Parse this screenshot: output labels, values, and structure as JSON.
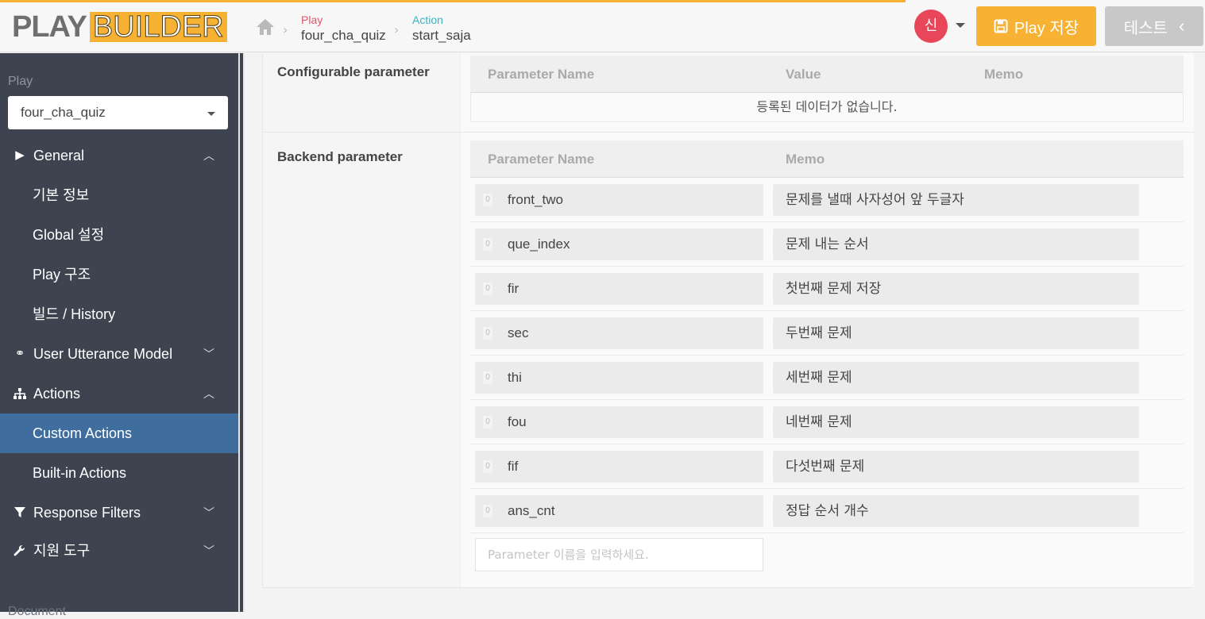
{
  "header": {
    "logo_play": "PLAY",
    "logo_builder": "BUILDER",
    "breadcrumb": [
      {
        "kind": "Play",
        "value": "four_cha_quiz"
      },
      {
        "kind": "Action",
        "value": "start_saja"
      }
    ],
    "avatar_initial": "신",
    "save_label": "Play 저장",
    "test_label": "테스트",
    "colors": {
      "accent": "#f7b233",
      "play_crumb": "#e05566",
      "action_crumb": "#3bb4c4",
      "avatar": "#e8475a"
    }
  },
  "sidebar": {
    "play_label": "Play",
    "play_select": "four_cha_quiz",
    "items": [
      {
        "label": "General",
        "icon": "play-icon",
        "arrow": "up"
      },
      {
        "label": "기본 정보",
        "sub": true
      },
      {
        "label": "Global 설정",
        "sub": true
      },
      {
        "label": "Play 구조",
        "sub": true
      },
      {
        "label": "빌드 / History",
        "sub": true
      },
      {
        "label": "User Utterance Model",
        "icon": "link-icon",
        "arrow": "down"
      },
      {
        "label": "Actions",
        "icon": "sitemap-icon",
        "arrow": "up"
      },
      {
        "label": "Custom Actions",
        "sub": true,
        "active": true
      },
      {
        "label": "Built-in Actions",
        "sub": true
      },
      {
        "label": "Response Filters",
        "icon": "filter-icon",
        "arrow": "down"
      },
      {
        "label": "지원 도구",
        "icon": "wrench-icon",
        "arrow": "down"
      }
    ],
    "faded_label": "Document"
  },
  "configurable": {
    "title": "Configurable parameter",
    "col_name": "Parameter Name",
    "col_value": "Value",
    "col_memo": "Memo",
    "empty_text": "등록된 데이터가 없습니다."
  },
  "backend": {
    "title": "Backend parameter",
    "col_name": "Parameter Name",
    "col_memo": "Memo",
    "rows": [
      {
        "name": "front_two",
        "memo": "문제를 낼때 사자성어 앞 두글자"
      },
      {
        "name": "que_index",
        "memo": "문제 내는 순서"
      },
      {
        "name": "fir",
        "memo": "첫번째 문제 저장"
      },
      {
        "name": "sec",
        "memo": "두번째 문제"
      },
      {
        "name": "thi",
        "memo": "세번째 문제"
      },
      {
        "name": "fou",
        "memo": "네번째 문제"
      },
      {
        "name": "fif",
        "memo": "다섯번째 문제"
      },
      {
        "name": "ans_cnt",
        "memo": "정답 순서 개수"
      }
    ],
    "row_tag": "0",
    "input_placeholder": "Parameter 이름을 입력하세요."
  }
}
